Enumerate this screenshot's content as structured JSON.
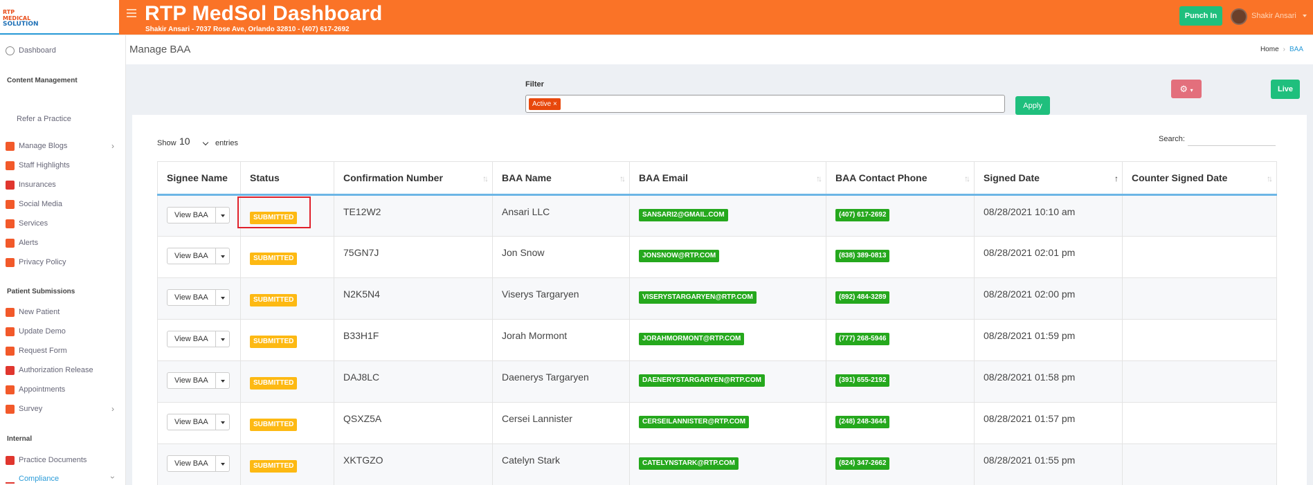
{
  "app": {
    "logo_line1": "RTP MEDICAL",
    "logo_line2": "SOLUTION",
    "title": "RTP MedSol Dashboard",
    "subtitle": "Shakir Ansari - 7037 Rose Ave, Orlando 32810 - (407) 617-2692",
    "punch_label": "Punch In",
    "user_name": "Shakir Ansari"
  },
  "sidebar": {
    "dashboard": "Dashboard",
    "content_heading": "Content Management",
    "refer": "Refer a Practice",
    "content_items": [
      "Manage Blogs",
      "Staff Highlights",
      "Insurances",
      "Social Media",
      "Services",
      "Alerts",
      "Privacy Policy"
    ],
    "patient_heading": "Patient Submissions",
    "patient_items": [
      "New Patient",
      "Update Demo",
      "Request Form",
      "Authorization Release",
      "Appointments",
      "Survey"
    ],
    "internal_heading": "Internal",
    "internal_items": [
      "Practice Documents",
      "Compliance"
    ]
  },
  "page": {
    "title": "Manage BAA",
    "breadcrumb_home": "Home",
    "breadcrumb_current": "BAA"
  },
  "filter": {
    "label": "Filter",
    "tag": "Active ×",
    "apply": "Apply",
    "live": "Live"
  },
  "table_controls": {
    "show": "Show",
    "page_size": "10",
    "entries": "entries",
    "search": "Search:"
  },
  "table": {
    "columns": [
      "Signee Name",
      "Status",
      "Confirmation Number",
      "BAA Name",
      "BAA Email",
      "BAA Contact Phone",
      "Signed Date",
      "Counter Signed Date"
    ],
    "view_label": "View BAA",
    "rows": [
      {
        "status": "SUBMITTED",
        "conf": "TE12W2",
        "name": "Ansari LLC",
        "email": "SANSARI2@GMAIL.COM",
        "phone": "(407) 617-2692",
        "signed": "08/28/2021 10:10 am",
        "counter": ""
      },
      {
        "status": "SUBMITTED",
        "conf": "75GN7J",
        "name": "Jon Snow",
        "email": "JONSNOW@RTP.COM",
        "phone": "(838) 389-0813",
        "signed": "08/28/2021 02:01 pm",
        "counter": ""
      },
      {
        "status": "SUBMITTED",
        "conf": "N2K5N4",
        "name": "Viserys Targaryen",
        "email": "VISERYSTARGARYEN@RTP.COM",
        "phone": "(892) 484-3289",
        "signed": "08/28/2021 02:00 pm",
        "counter": ""
      },
      {
        "status": "SUBMITTED",
        "conf": "B33H1F",
        "name": "Jorah Mormont",
        "email": "JORAHMORMONT@RTP.COM",
        "phone": "(777) 268-5946",
        "signed": "08/28/2021 01:59 pm",
        "counter": ""
      },
      {
        "status": "SUBMITTED",
        "conf": "DAJ8LC",
        "name": "Daenerys Targaryen",
        "email": "DAENERYSTARGARYEN@RTP.COM",
        "phone": "(391) 655-2192",
        "signed": "08/28/2021 01:58 pm",
        "counter": ""
      },
      {
        "status": "SUBMITTED",
        "conf": "QSXZ5A",
        "name": "Cersei Lannister",
        "email": "CERSEILANNISTER@RTP.COM",
        "phone": "(248) 248-3644",
        "signed": "08/28/2021 01:57 pm",
        "counter": ""
      },
      {
        "status": "SUBMITTED",
        "conf": "XKTGZO",
        "name": "Catelyn Stark",
        "email": "CATELYNSTARK@RTP.COM",
        "phone": "(824) 347-2662",
        "signed": "08/28/2021 01:55 pm",
        "counter": ""
      }
    ]
  }
}
